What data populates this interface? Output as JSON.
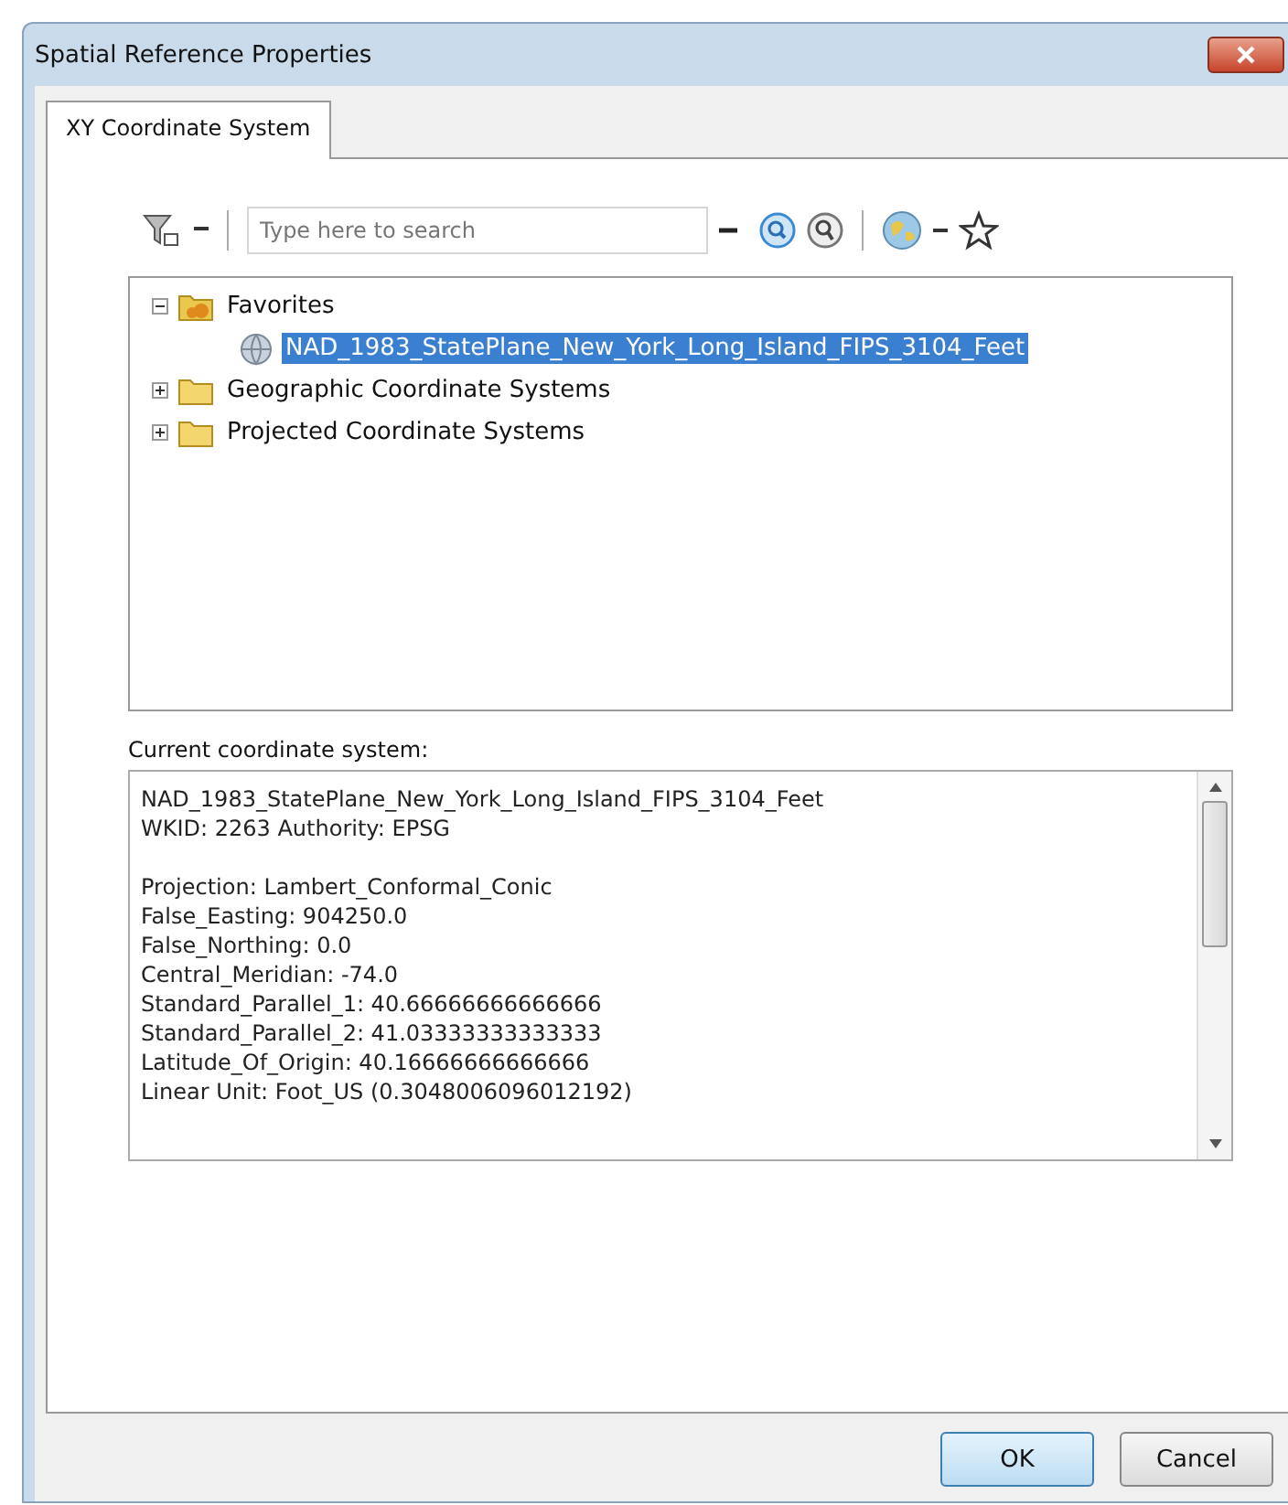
{
  "window": {
    "title": "Spatial Reference Properties"
  },
  "tabs": [
    {
      "label": "XY Coordinate System",
      "selected": true
    }
  ],
  "search": {
    "placeholder": "Type here to search"
  },
  "tree": [
    {
      "label": "Favorites",
      "kind": "favorites",
      "expanded": true,
      "selected": false,
      "children": [
        {
          "label": "NAD_1983_StatePlane_New_York_Long_Island_FIPS_3104_Feet",
          "kind": "crs",
          "selected": true
        }
      ]
    },
    {
      "label": "Geographic Coordinate Systems",
      "kind": "folder",
      "expanded": false,
      "selected": false
    },
    {
      "label": "Projected Coordinate Systems",
      "kind": "folder",
      "expanded": false,
      "selected": false
    }
  ],
  "current": {
    "label": "Current coordinate system:",
    "groups": [
      [
        "NAD_1983_StatePlane_New_York_Long_Island_FIPS_3104_Feet",
        "WKID: 2263 Authority: EPSG"
      ],
      [
        "Projection: Lambert_Conformal_Conic",
        "False_Easting: 904250.0",
        "False_Northing: 0.0",
        "Central_Meridian: -74.0",
        "Standard_Parallel_1: 40.66666666666666",
        "Standard_Parallel_2: 41.03333333333333",
        "Latitude_Of_Origin: 40.16666666666666",
        "Linear Unit: Foot_US (0.3048006096012192)"
      ]
    ]
  },
  "buttons": [
    {
      "label": "OK",
      "kind": "default"
    },
    {
      "label": "Cancel",
      "kind": "normal"
    }
  ]
}
